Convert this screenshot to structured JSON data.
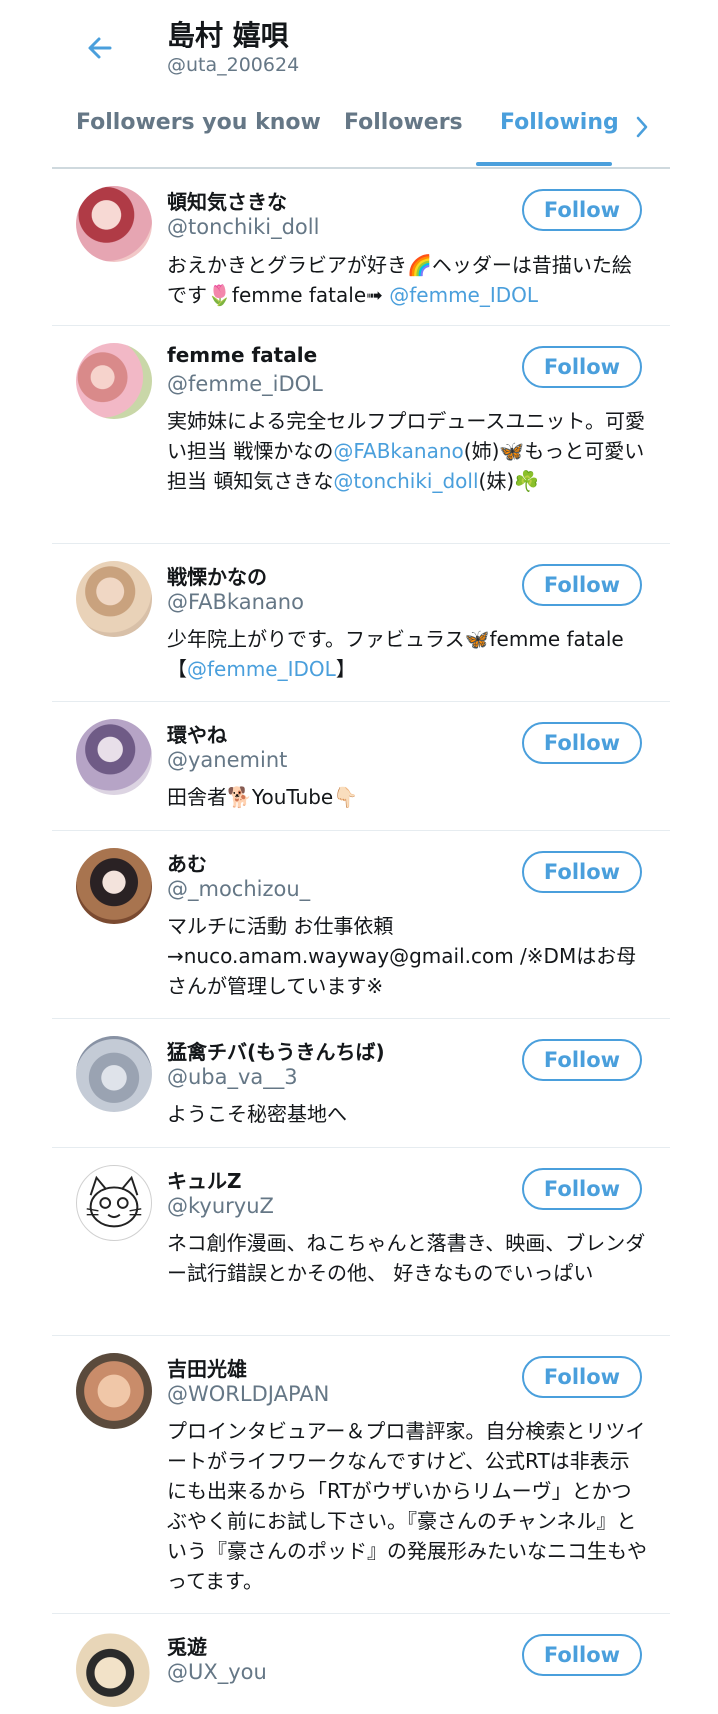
{
  "header": {
    "name": "島村 嬉唄",
    "handle": "@uta_200624"
  },
  "tabs": [
    {
      "label": "Followers you know"
    },
    {
      "label": "Followers"
    },
    {
      "label": "Following",
      "active": true
    }
  ],
  "accent_color": "#4a9fdc",
  "users": [
    {
      "name": "頓知気さきな",
      "handle": "@tonchiki_doll",
      "follow_label": "Follow",
      "bio_parts": [
        {
          "text": "おえかきとグラビアが好き🌈ヘッダーは昔描いた絵です🌷femme fatale➟ "
        },
        {
          "text": "@femme_IDOL",
          "link": true
        }
      ]
    },
    {
      "name": "femme fatale",
      "handle": "@femme_iDOL",
      "follow_label": "Follow",
      "bio_parts": [
        {
          "text": "実姉妹による完全セルフプロデュースユニット。可愛い担当 戦慄かなの"
        },
        {
          "text": "@FABkanano",
          "link": true
        },
        {
          "text": "(姉)🦋もっと可愛い担当 頓知気さきな"
        },
        {
          "text": "@tonchiki_doll",
          "link": true
        },
        {
          "text": "(妹)☘️"
        }
      ]
    },
    {
      "name": "戦慄かなの",
      "handle": "@FABkanano",
      "follow_label": "Follow",
      "bio_parts": [
        {
          "text": "少年院上がりです。ファビュラス🦋femme fatale【"
        },
        {
          "text": "@femme_IDOL",
          "link": true
        },
        {
          "text": "】"
        }
      ]
    },
    {
      "name": "環やね",
      "handle": "@yanemint",
      "follow_label": "Follow",
      "bio_parts": [
        {
          "text": "田舎者🐕YouTube👇🏻"
        }
      ]
    },
    {
      "name": "あむ",
      "handle": "@_mochizou_",
      "follow_label": "Follow",
      "bio_parts": [
        {
          "text": "マルチに活動 お仕事依頼→nuco.amam.wayway@gmail.com /※DMはお母さんが管理しています※"
        }
      ]
    },
    {
      "name": "猛禽チバ(もうきんちば)",
      "handle": "@uba_va__3",
      "follow_label": "Follow",
      "bio_parts": [
        {
          "text": "ようこそ秘密基地へ"
        }
      ]
    },
    {
      "name": "キュルZ",
      "handle": "@kyuryuZ",
      "follow_label": "Follow",
      "bio_parts": [
        {
          "text": "ネコ創作漫画、ねこちゃんと落書き、映画、ブレンダー試行錯誤とかその他、 好きなものでいっぱい"
        }
      ]
    },
    {
      "name": "吉田光雄",
      "handle": "@WORLDJAPAN",
      "follow_label": "Follow",
      "bio_parts": [
        {
          "text": "プロインタビュアー＆プロ書評家。自分検索とリツイートがライフワークなんですけど、公式RTは非表示にも出来るから「RTがウザいからリムーヴ」とかつぶやく前にお試し下さい。『豪さんのチャンネル』という『豪さんのポッド』の発展形みたいなニコ生もやってます。"
        }
      ]
    },
    {
      "name": "兎遊",
      "handle": "@UX_you",
      "follow_label": "Follow",
      "bio_parts": []
    }
  ]
}
